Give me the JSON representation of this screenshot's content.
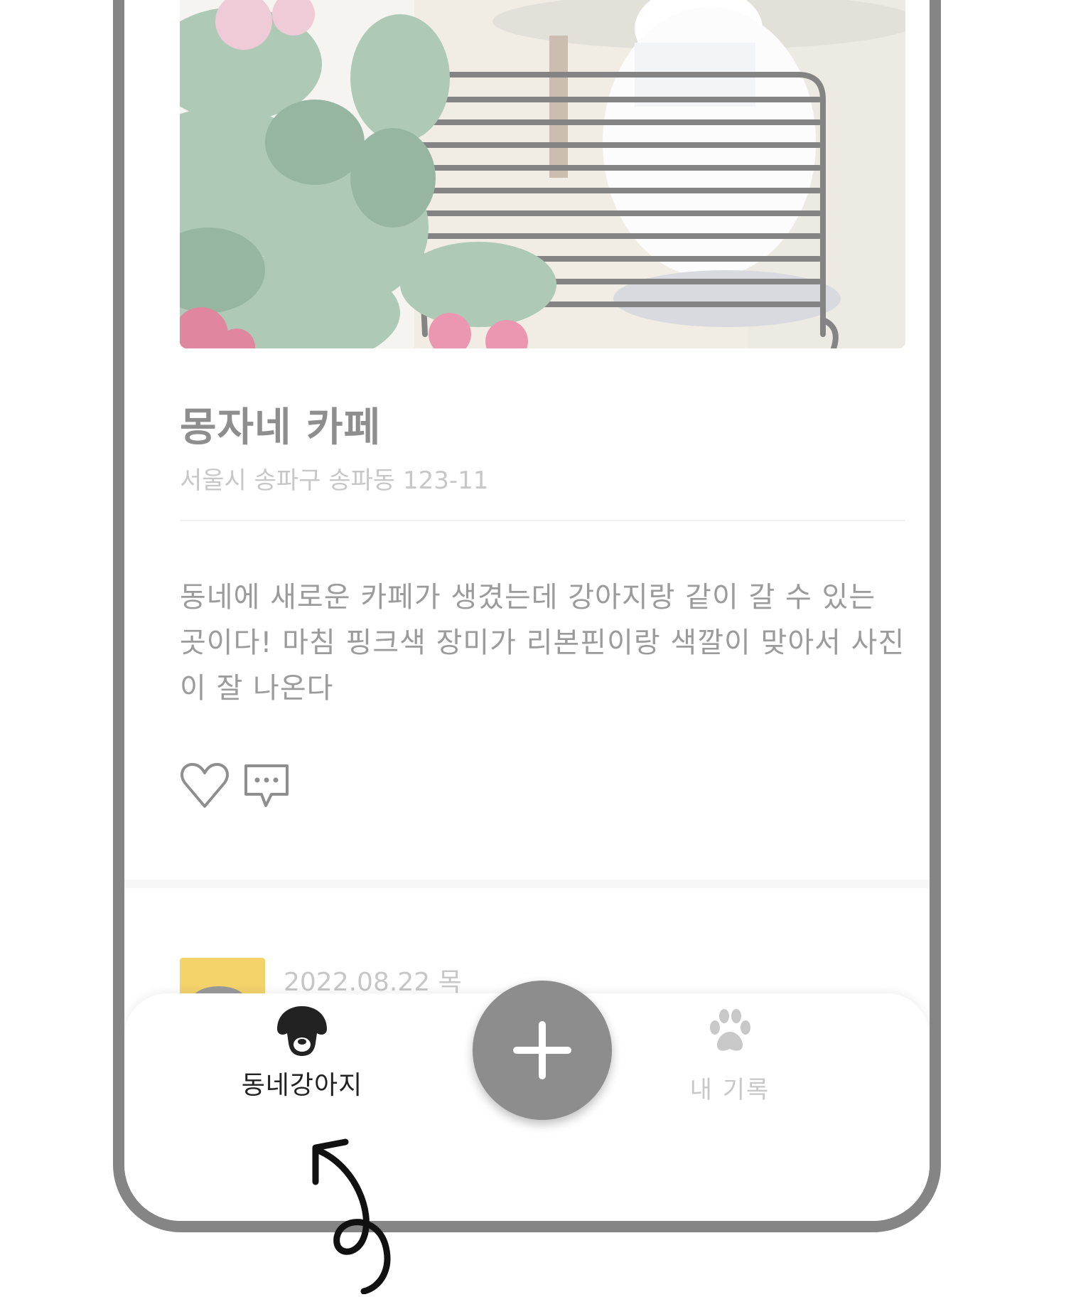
{
  "post": {
    "title": "몽자네 카페",
    "address": "서울시 송파구 송파동 123-11",
    "body": "동네에 새로운 카페가 생겼는데 강아지랑 같이 갈 수 있는 곳이다! 마침 핑크색 장미가 리본핀이랑 색깔이 맞아서 사진이 잘 나온다",
    "photo_icon": "photo-dog-cafe",
    "like_icon": "heart-outline-icon",
    "comment_icon": "speech-bubble-dots-icon"
  },
  "next_post": {
    "date": "2022.08.22 목"
  },
  "bottom_nav": {
    "home_label": "동네강아지",
    "home_icon": "dog-head-icon",
    "add_icon": "plus-icon",
    "records_label": "내 기록",
    "records_icon": "paw-icon"
  },
  "colors": {
    "frame": "#858585",
    "add_button": "#8d8d8d",
    "active_text": "#222222",
    "inactive_text": "#c8c8c8"
  }
}
